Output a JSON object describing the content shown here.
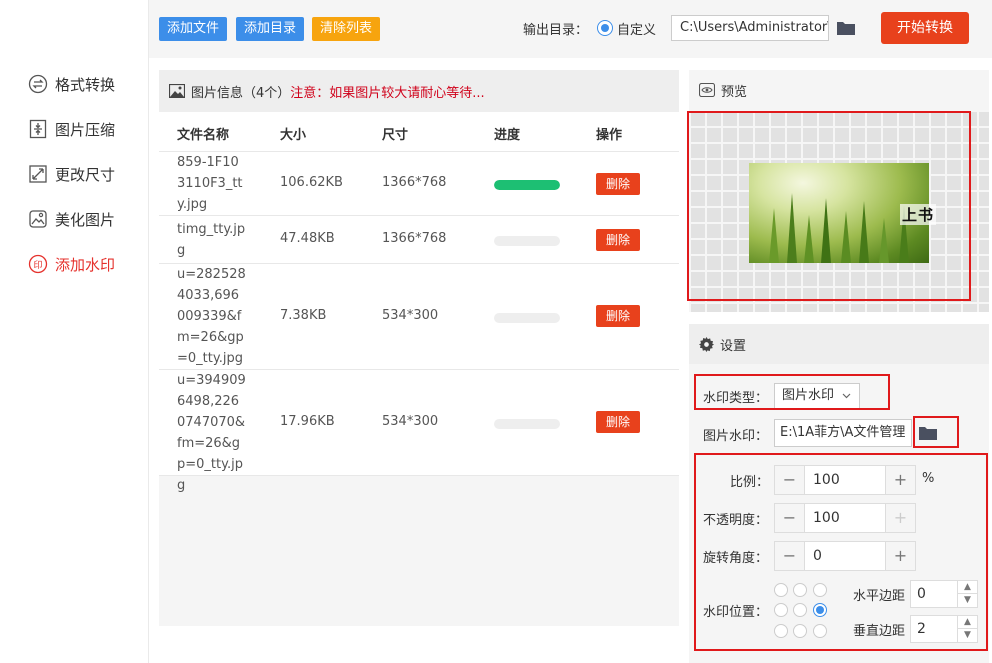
{
  "sidebar": {
    "items": [
      {
        "label": "格式转换",
        "icon": "format-convert-icon",
        "active": false
      },
      {
        "label": "图片压缩",
        "icon": "compress-icon",
        "active": false
      },
      {
        "label": "更改尺寸",
        "icon": "resize-icon",
        "active": false
      },
      {
        "label": "美化图片",
        "icon": "beautify-icon",
        "active": false
      },
      {
        "label": "添加水印",
        "icon": "watermark-icon",
        "active": true
      }
    ]
  },
  "toolbar": {
    "add_file": "添加文件",
    "add_folder": "添加目录",
    "clear_list": "清除列表",
    "output_label": "输出目录：",
    "output_option": "自定义",
    "output_path": "C:\\Users\\Administrator\\",
    "start": "开始转换"
  },
  "file_panel": {
    "title": "图片信息（4个）",
    "warning": "注意：如果图片较大请耐心等待...",
    "columns": [
      "文件名称",
      "大小",
      "尺寸",
      "进度",
      "操作"
    ],
    "rows": [
      {
        "name": "859-1F103110F3_tty.jpg",
        "size": "106.62KB",
        "dims": "1366*768",
        "progress": 1.0,
        "action": "删除"
      },
      {
        "name": "timg_tty.jpg",
        "size": "47.48KB",
        "dims": "1366*768",
        "progress": 0,
        "action": "删除"
      },
      {
        "name": "u=2825284033,696009339&fm=26&gp=0_tty.jpg",
        "size": "7.38KB",
        "dims": "534*300",
        "progress": 0,
        "action": "删除"
      },
      {
        "name": "u=3949096498,2260747070&fm=26&gp=0_tty.jpg",
        "size": "17.96KB",
        "dims": "534*300",
        "progress": 0,
        "action": "删除"
      }
    ]
  },
  "preview": {
    "title": "预览",
    "watermark_text": "上书"
  },
  "settings": {
    "title": "设置",
    "type_label": "水印类型：",
    "type_value": "图片水印",
    "image_label": "图片水印：",
    "image_path": "E:\\1A菲方\\A文件管理",
    "scale_label": "比例：",
    "scale_value": "100",
    "scale_unit": "%",
    "opacity_label": "不透明度：",
    "opacity_value": "100",
    "rotation_label": "旋转角度：",
    "rotation_value": "0",
    "position_label": "水印位置：",
    "position_selected": 5,
    "h_margin_label": "水平边距",
    "h_margin_value": "0",
    "v_margin_label": "垂直边距",
    "v_margin_value": "2"
  },
  "colors": {
    "accent_blue": "#3c8ee9",
    "accent_orange": "#f7a40e",
    "start_red": "#e8411c",
    "active_red": "#e5322d",
    "progress_green": "#1dbf73",
    "annotation_red": "#e0191b"
  }
}
